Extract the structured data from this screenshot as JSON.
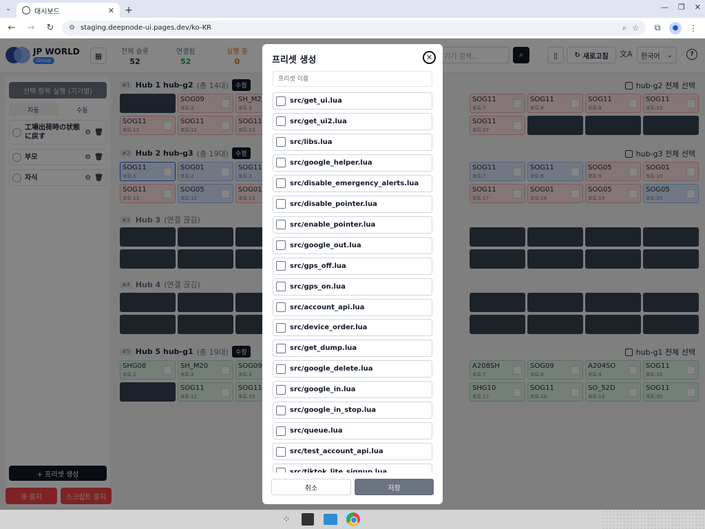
{
  "browser": {
    "tab_title": "대시보드",
    "url": "staging.deepnode-ui.pages.dev/ko-KR"
  },
  "app": {
    "brand": "JP WORLD",
    "brand_sub": "Group",
    "stats": [
      {
        "label": "전체 슬롯",
        "value": "52",
        "color": "#1f2937"
      },
      {
        "label": "연결됨",
        "value": "52",
        "color": "#16a34a"
      },
      {
        "label": "실행 중",
        "value": "0",
        "color": "#d97706"
      }
    ],
    "search_placeholder": "기기 검색...",
    "refresh_label": "새로고침",
    "language": "한국어"
  },
  "sidebar": {
    "run_selected": "선택 항목 실행 (기기별)",
    "mode_tabs": [
      "자동",
      "수동"
    ],
    "presets": [
      "工場出荷時の状態に戻す",
      "부모",
      "자식"
    ],
    "add_preset": "+ 프리셋 생성",
    "stop_queue": "큐 중지",
    "stop_script": "스크립트 중지"
  },
  "hubs": [
    {
      "num": "#1",
      "name": "Hub 1 hub-g2",
      "count": "(총 14대)",
      "edit": "수정",
      "select_all": "hub-g2 전체 선택"
    },
    {
      "num": "#2",
      "name": "Hub 2 hub-g3",
      "count": "(총 19대)",
      "edit": "수정",
      "select_all": "hub-g3 전체 선택"
    },
    {
      "num": "#3",
      "name": "Hub 3",
      "count": "(연결 끊김)"
    },
    {
      "num": "#4",
      "name": "Hub 4",
      "count": "(연결 끊김)"
    },
    {
      "num": "#5",
      "name": "Hub 5 hub-g1",
      "count": "(총 19대)",
      "edit": "수정",
      "select_all": "hub-g1 전체 선택"
    }
  ],
  "devices": {
    "hub1_row1": [
      {
        "c": "dark"
      },
      {
        "c": "red",
        "n": "SOG09",
        "p": "포트:2"
      },
      {
        "c": "red",
        "n": "SH_M2",
        "p": "포트:3"
      },
      {
        "c": "red",
        "n": "SOG11",
        "p": "포트:7"
      },
      {
        "c": "red",
        "n": "SOG11",
        "p": "포트:8"
      },
      {
        "c": "red",
        "n": "SOG11",
        "p": "포트:9"
      },
      {
        "c": "red",
        "n": "SOG11",
        "p": "포트:10"
      }
    ],
    "hub1_row2": [
      {
        "c": "red",
        "n": "SOG11",
        "p": "포트:11"
      },
      {
        "c": "red",
        "n": "SOG11",
        "p": "포트:12"
      },
      {
        "c": "red",
        "n": "SOG11",
        "p": "포트:13"
      },
      {
        "c": "red",
        "n": "SOG11",
        "p": "포트:17"
      },
      {
        "c": "dark"
      },
      {
        "c": "dark"
      },
      {
        "c": "dark"
      }
    ],
    "hub2_row1": [
      {
        "c": "blue",
        "n": "SOG11",
        "p": "포트:1",
        "sel": true
      },
      {
        "c": "blue",
        "n": "SOG01",
        "p": "포트:2"
      },
      {
        "c": "blue",
        "n": "SOG11",
        "p": "포트:3"
      },
      {
        "c": "blue",
        "n": "SOG11",
        "p": "포트:7"
      },
      {
        "c": "blue",
        "n": "SOG11",
        "p": "포트:8"
      },
      {
        "c": "red",
        "n": "SOG05",
        "p": "포트:9"
      },
      {
        "c": "red",
        "n": "SOG01",
        "p": "포트:10"
      }
    ],
    "hub2_row2": [
      {
        "c": "red",
        "n": "SOG11",
        "p": "포트:11"
      },
      {
        "c": "blue",
        "n": "SOG05",
        "p": "포트:12"
      },
      {
        "c": "red",
        "n": "SOG01",
        "p": "포트:13"
      },
      {
        "c": "red",
        "n": "SOG11",
        "p": "포트:17"
      },
      {
        "c": "red",
        "n": "SOG01",
        "p": "포트:18"
      },
      {
        "c": "red",
        "n": "SOG05",
        "p": "포트:19"
      },
      {
        "c": "blue",
        "n": "SOG05",
        "p": "포트:20"
      }
    ],
    "hub5_row1": [
      {
        "c": "green",
        "n": "SHG08",
        "p": "포트:1"
      },
      {
        "c": "green",
        "n": "SH_M20",
        "p": "포트:2"
      },
      {
        "c": "green",
        "n": "SOG09",
        "p": "포트:3"
      },
      {
        "c": "green",
        "n": "A208SH",
        "p": "포트:7"
      },
      {
        "c": "green",
        "n": "SOG09",
        "p": "포트:8"
      },
      {
        "c": "green",
        "n": "A204SO",
        "p": "포트:9"
      },
      {
        "c": "green",
        "n": "SOG11",
        "p": "포트:10"
      }
    ],
    "hub5_row2": [
      {
        "c": "dark"
      },
      {
        "c": "green",
        "n": "SOG11",
        "p": "포트:12"
      },
      {
        "c": "green",
        "n": "SOG11",
        "p": "포트:13"
      },
      {
        "c": "green",
        "n": "SHG10",
        "p": "포트:17"
      },
      {
        "c": "green",
        "n": "SOG11",
        "p": "포트:18"
      },
      {
        "c": "green",
        "n": "SO_52D",
        "p": "포트:19"
      },
      {
        "c": "green",
        "n": "SOG11",
        "p": "포트:20"
      }
    ]
  },
  "modal": {
    "title": "프리셋 생성",
    "name_placeholder": "프리셋 이름",
    "scripts": [
      "src/get_ui.lua",
      "src/get_ui2.lua",
      "src/libs.lua",
      "src/google_helper.lua",
      "src/disable_emergency_alerts.lua",
      "src/disable_pointer.lua",
      "src/enable_pointer.lua",
      "src/google_out.lua",
      "src/gps_off.lua",
      "src/gps_on.lua",
      "src/account_api.lua",
      "src/device_order.lua",
      "src/get_dump.lua",
      "src/google_delete.lua",
      "src/google_in.lua",
      "src/google_in_stop.lua",
      "src/queue.lua",
      "src/test_account_api.lua",
      "src/tiktok_lite_signup.lua"
    ],
    "cancel": "취소",
    "save": "저장"
  }
}
